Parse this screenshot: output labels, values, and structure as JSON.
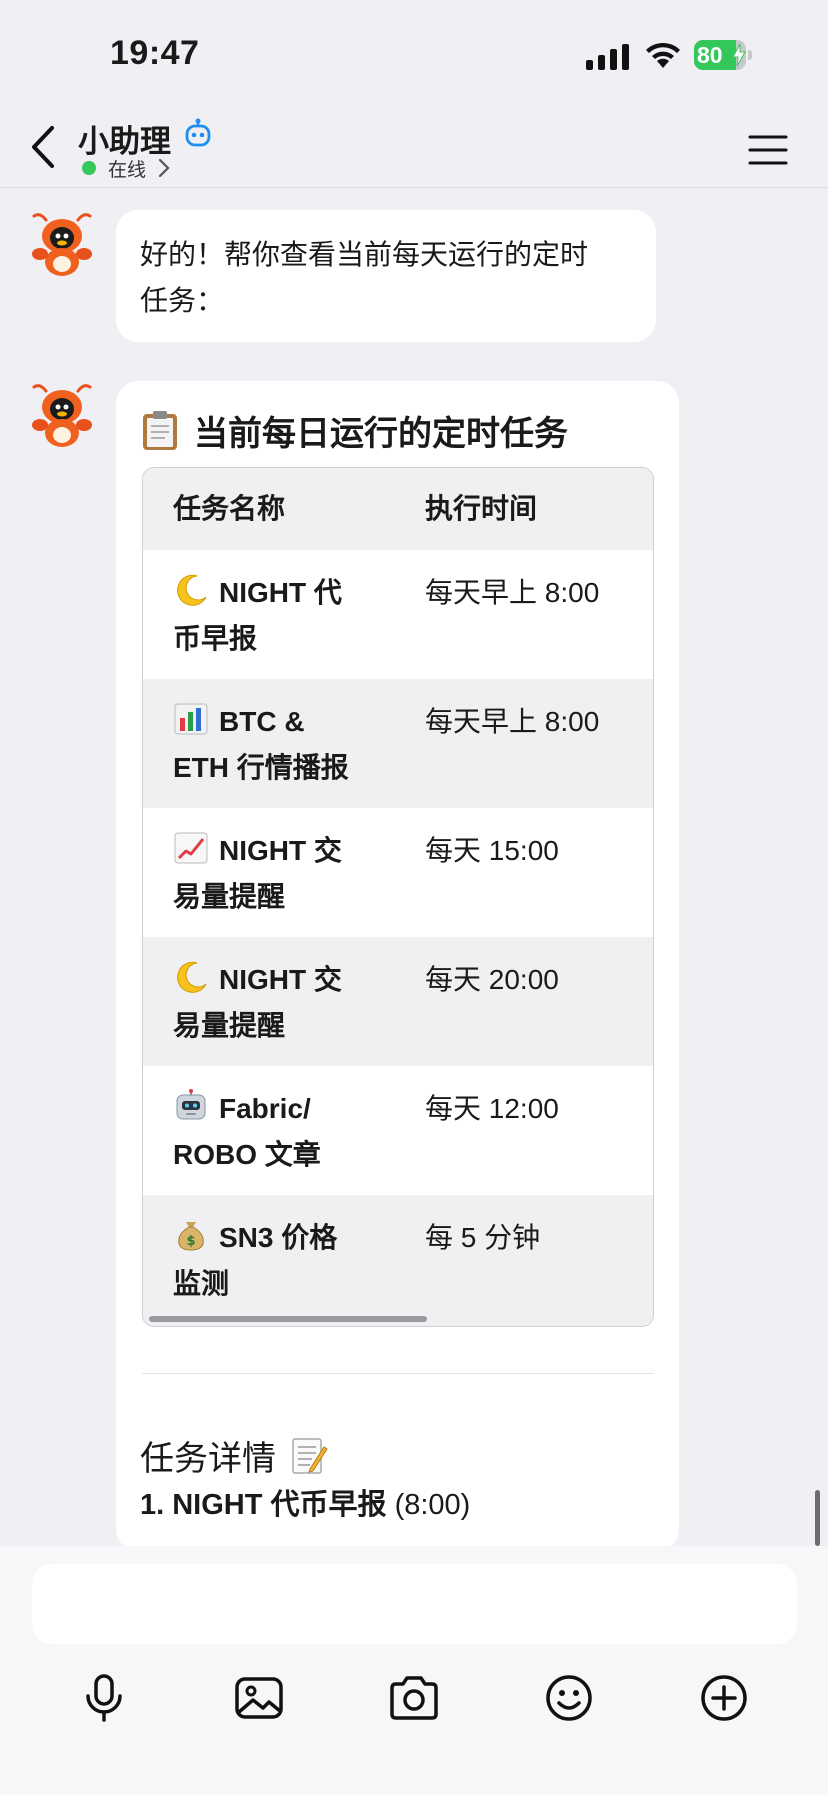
{
  "status_bar": {
    "time": "19:47",
    "battery_level": 80,
    "battery_text": "80"
  },
  "header": {
    "title": "小助理",
    "status": "在线"
  },
  "messages": {
    "text_1_line1": "好的！帮你查看当前每天运行的定时",
    "text_1_line2": "任务：",
    "card_title": "当前每日运行的定时任务",
    "table": {
      "headers": [
        "任务名称",
        "执行时间"
      ],
      "rows": [
        {
          "icon": "crescent-moon-icon",
          "name_l1": "NIGHT 代",
          "name_l2": "币早报",
          "time": "每天早上 8:00"
        },
        {
          "icon": "bar-chart-icon",
          "name_l1": "BTC &",
          "name_l2": "ETH 行情播报",
          "time": "每天早上 8:00"
        },
        {
          "icon": "chart-increasing-icon",
          "name_l1": "NIGHT 交",
          "name_l2": "易量提醒",
          "time": "每天 15:00"
        },
        {
          "icon": "crescent-moon-icon",
          "name_l1": "NIGHT 交",
          "name_l2": "易量提醒",
          "time": "每天 20:00"
        },
        {
          "icon": "robot-icon",
          "name_l1": "Fabric/",
          "name_l2": "ROBO 文章",
          "time": "每天 12:00"
        },
        {
          "icon": "money-bag-icon",
          "name_l1": "SN3 价格",
          "name_l2": "监测",
          "time": "每 5 分钟"
        }
      ]
    },
    "section_title": "任务详情",
    "detail_bold": "1. NIGHT 代币早报",
    "detail_rest": " (8:00)"
  },
  "toolbar": {
    "items": [
      "microphone-icon",
      "image-icon",
      "camera-icon",
      "emoji-icon",
      "plus-circle-icon"
    ]
  },
  "colors": {
    "accent_green": "#34c759",
    "background": "#efeff4",
    "bubble": "#ffffff",
    "bot_blue": "#1f8ef1"
  }
}
